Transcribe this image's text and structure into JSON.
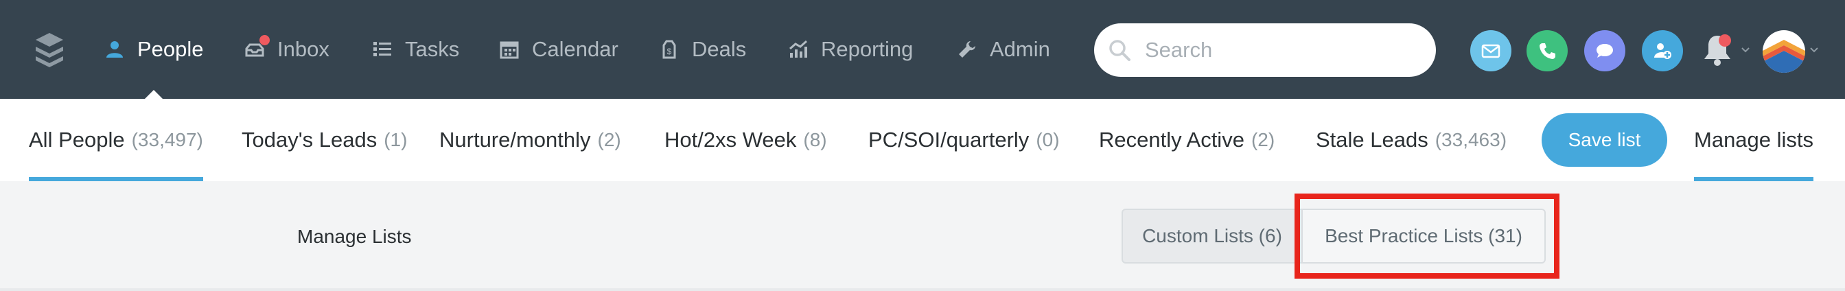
{
  "nav": {
    "items": [
      {
        "label": "People",
        "icon": "person-icon"
      },
      {
        "label": "Inbox",
        "icon": "inbox-icon"
      },
      {
        "label": "Tasks",
        "icon": "tasks-list-icon"
      },
      {
        "label": "Calendar",
        "icon": "calendar-icon"
      },
      {
        "label": "Deals",
        "icon": "deals-tag-icon"
      },
      {
        "label": "Reporting",
        "icon": "reporting-chart-icon"
      },
      {
        "label": "Admin",
        "icon": "wrench-icon"
      }
    ],
    "active": "People"
  },
  "search": {
    "placeholder": "Search"
  },
  "actions": [
    {
      "name": "email",
      "icon": "envelope-icon",
      "color": "#6ec4ea"
    },
    {
      "name": "call",
      "icon": "phone-icon",
      "color": "#3ec17f"
    },
    {
      "name": "text",
      "icon": "chat-bubble-icon",
      "color": "#7f8ef0"
    },
    {
      "name": "add-person",
      "icon": "add-person-icon",
      "color": "#45a8dc"
    }
  ],
  "colors": {
    "topbar": "#36444f",
    "accent": "#45a8dc",
    "notification": "#ef5a5f",
    "highlight": "#e8251c"
  },
  "tabs": [
    {
      "label": "All People",
      "count": "(33,497)"
    },
    {
      "label": "Today's Leads",
      "count": "(1)"
    },
    {
      "label": "Nurture/monthly",
      "count": "(2)"
    },
    {
      "label": "Hot/2xs Week",
      "count": "(8)"
    },
    {
      "label": "PC/SOI/quarterly",
      "count": "(0)"
    },
    {
      "label": "Recently Active",
      "count": "(2)"
    },
    {
      "label": "Stale Leads",
      "count": "(33,463)"
    }
  ],
  "save_button": "Save list",
  "manage_tab": "Manage lists",
  "panel": {
    "title": "Manage Lists",
    "segments": [
      {
        "label": "Custom Lists (6)"
      },
      {
        "label": "Best Practice Lists (31)"
      }
    ],
    "selected_segment": "Best Practice Lists (31)"
  }
}
